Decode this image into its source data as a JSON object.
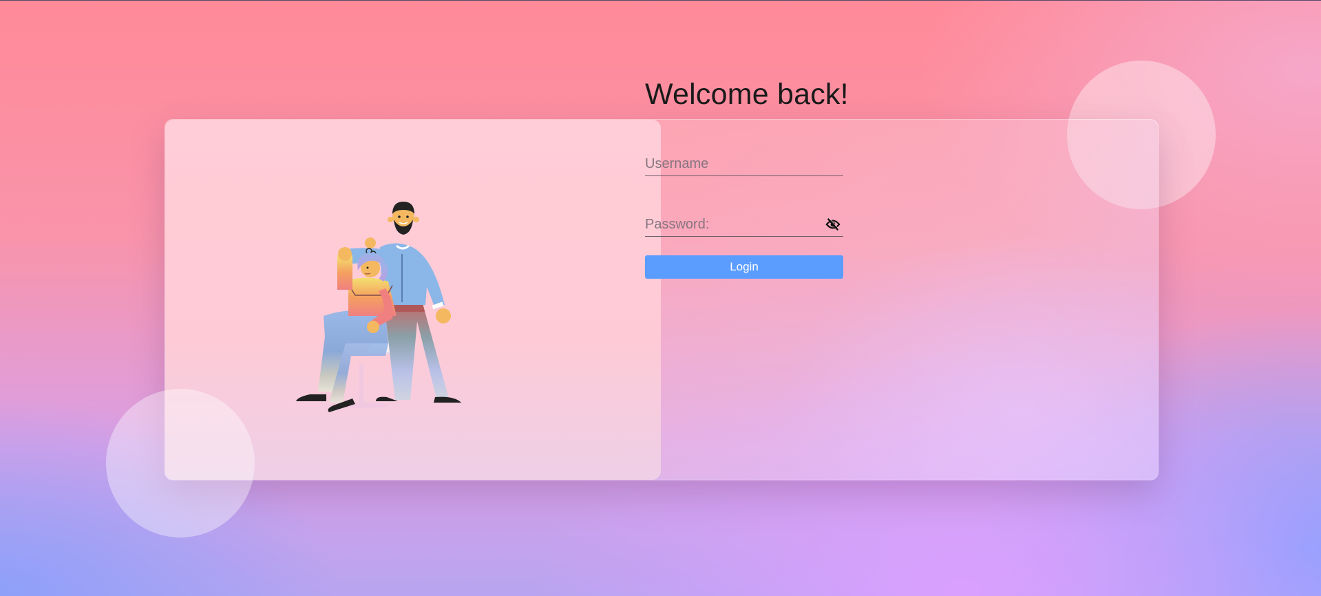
{
  "login": {
    "title": "Welcome back!",
    "username_placeholder": "Username",
    "password_placeholder": "Password:",
    "login_label": "Login"
  },
  "illustration": {
    "icon": "barber-cutting-hair-illustration"
  },
  "icons": {
    "password_toggle": "eye-slash-icon"
  },
  "colors": {
    "button": "#5b9cff",
    "button_text": "#ffffff",
    "background_top": "#ff8a98",
    "background_bottom": "#b8a4f0",
    "left_panel": "#ffcdd8"
  }
}
